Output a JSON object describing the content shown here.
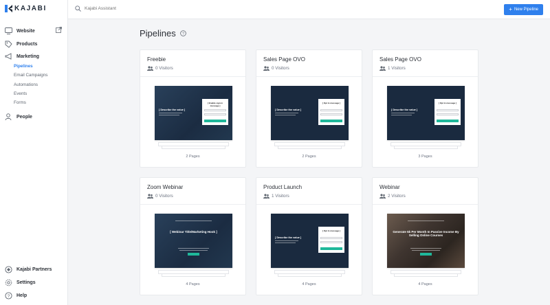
{
  "app": {
    "logo_text": "KAJABI",
    "accent_color": "#2f80ed"
  },
  "sidebar": {
    "items": [
      {
        "label": "Website",
        "icon": "monitor-icon"
      },
      {
        "label": "Products",
        "icon": "tag-icon"
      },
      {
        "label": "Marketing",
        "icon": "megaphone-icon"
      },
      {
        "label": "People",
        "icon": "person-icon"
      }
    ],
    "marketing_sub": [
      {
        "label": "Pipelines",
        "active": true
      },
      {
        "label": "Email Campaigns",
        "active": false
      },
      {
        "label": "Automations",
        "active": false
      },
      {
        "label": "Events",
        "active": false
      },
      {
        "label": "Forms",
        "active": false
      }
    ],
    "bottom_items": [
      {
        "label": "Kajabi Partners",
        "icon": "partners-icon"
      },
      {
        "label": "Settings",
        "icon": "gear-icon"
      },
      {
        "label": "Help",
        "icon": "help-icon"
      }
    ]
  },
  "header": {
    "search_placeholder": "Kajabi Assistant",
    "new_button_label": "New Pipeline"
  },
  "main": {
    "title": "Pipelines",
    "cards": [
      {
        "title": "Freebie",
        "visitors": "0 Visitors",
        "pages": "2 Pages",
        "preview": {
          "style": "blue",
          "headline": "[ Describe the value ]",
          "form_title": "[ Enable sign in message ]"
        }
      },
      {
        "title": "Sales Page OVO",
        "visitors": "0 Visitors",
        "pages": "2 Pages",
        "preview": {
          "style": "dark",
          "headline": "[ Describe the value ]",
          "form_title": "[ Opt in message ]"
        }
      },
      {
        "title": "Sales Page OVO",
        "visitors": "1 Visitors",
        "pages": "3 Pages",
        "preview": {
          "style": "dark",
          "headline": "[ Describe the value ]",
          "form_title": "[ Opt in message ]"
        }
      },
      {
        "title": "Zoom Webinar",
        "visitors": "0 Visitors",
        "pages": "4 Pages",
        "preview": {
          "style": "blue",
          "headline": "[ Webinar Title/Marketing Hook ]",
          "form_title": ""
        }
      },
      {
        "title": "Product Launch",
        "visitors": "1 Visitors",
        "pages": "4 Pages",
        "preview": {
          "style": "dark",
          "headline": "[ Describe the value ]",
          "form_title": "[ Opt in message ]"
        }
      },
      {
        "title": "Webinar",
        "visitors": "2 Visitors",
        "pages": "4 Pages",
        "preview": {
          "style": "photo",
          "headline": "Generate 5k Per Month In Passive Income By Selling Online Courses",
          "form_title": ""
        }
      }
    ]
  }
}
